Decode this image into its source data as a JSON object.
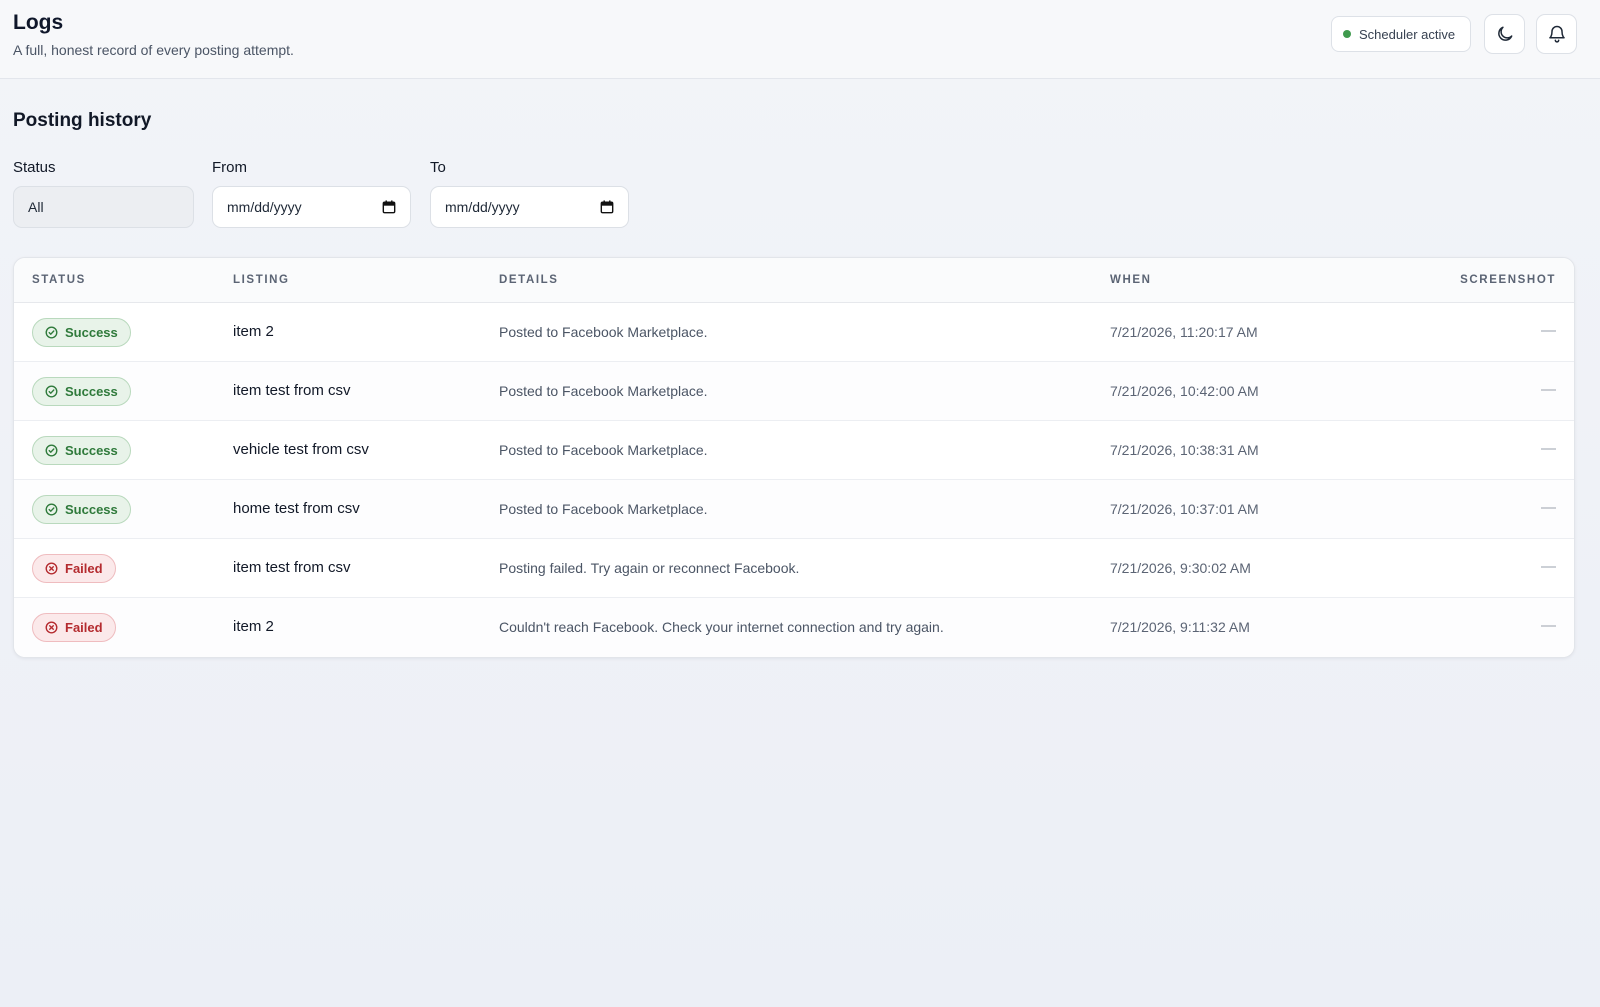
{
  "header": {
    "title": "Logs",
    "subtitle": "A full, honest record of every posting attempt.",
    "scheduler_status": "Scheduler active",
    "theme_toggle_icon": "moon-icon",
    "notifications_icon": "bell-icon",
    "status_dot_color": "#3f9a4d"
  },
  "history": {
    "title": "Posting history",
    "filters": {
      "status_label": "Status",
      "status_value": "All",
      "from_label": "From",
      "from_placeholder": "mm/dd/yyyy",
      "to_label": "To",
      "to_placeholder": "mm/dd/yyyy"
    },
    "columns": {
      "status": "STATUS",
      "listing": "LISTING",
      "details": "DETAILS",
      "when": "WHEN",
      "screenshot": "SCREENSHOT"
    },
    "rows": [
      {
        "status": "Success",
        "status_type": "success",
        "listing": "item 2",
        "details": "Posted to Facebook Marketplace.",
        "when": "7/21/2026, 11:20:17 AM",
        "screenshot": "—"
      },
      {
        "status": "Success",
        "status_type": "success",
        "listing": "item test from csv",
        "details": "Posted to Facebook Marketplace.",
        "when": "7/21/2026, 10:42:00 AM",
        "screenshot": "—"
      },
      {
        "status": "Success",
        "status_type": "success",
        "listing": "vehicle test from csv",
        "details": "Posted to Facebook Marketplace.",
        "when": "7/21/2026, 10:38:31 AM",
        "screenshot": "—"
      },
      {
        "status": "Success",
        "status_type": "success",
        "listing": "home test from csv",
        "details": "Posted to Facebook Marketplace.",
        "when": "7/21/2026, 10:37:01 AM",
        "screenshot": "—"
      },
      {
        "status": "Failed",
        "status_type": "failed",
        "listing": "item test from csv",
        "details": "Posting failed. Try again or reconnect Facebook.",
        "when": "7/21/2026, 9:30:02 AM",
        "screenshot": "—"
      },
      {
        "status": "Failed",
        "status_type": "failed",
        "listing": "item 2",
        "details": "Couldn't reach Facebook. Check your internet connection and try again.",
        "when": "7/21/2026, 9:11:32 AM",
        "screenshot": "—"
      }
    ],
    "status_colors": {
      "success": "#2f7a3b",
      "failed": "#b42b2f"
    }
  }
}
